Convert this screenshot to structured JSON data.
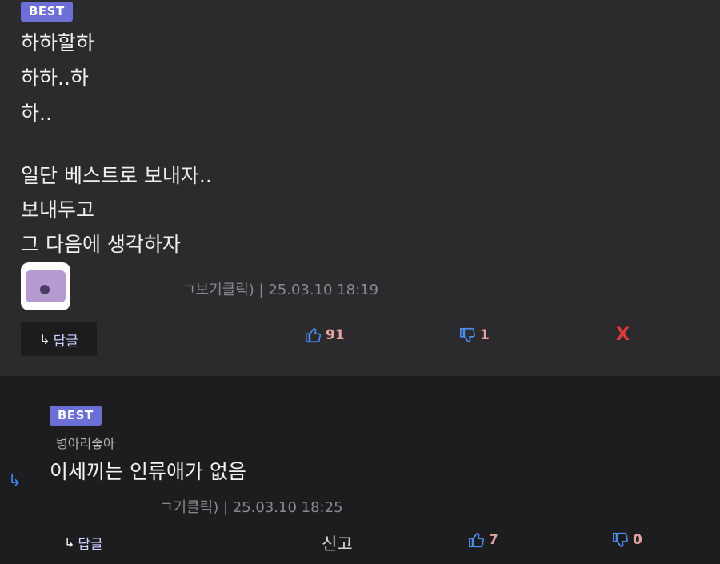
{
  "comment1": {
    "badge": "BEST",
    "lines": [
      "하하할하",
      "하하..하",
      "하..",
      "",
      "일단 베스트로 보내자..",
      "보내두고",
      "그 다음에 생각하자"
    ],
    "meta": "ㄱ보기클릭) | 25.03.10 18:19",
    "reply_label": "답글",
    "upvotes": "91",
    "downvotes": "1",
    "delete_label": "X"
  },
  "comment2": {
    "badge": "BEST",
    "nickname": "병아리좋아",
    "text": "이세끼는 인류애가 없음",
    "meta": "ㄱ기클릭) | 25.03.10 18:25",
    "reply_label": "답글",
    "report_label": "신고",
    "upvotes": "7",
    "downvotes": "0"
  },
  "colors": {
    "badge": "#6b6fd6",
    "count": "#e7a3a3",
    "delete": "#e03b3b",
    "reply_indicator": "#3d8bff"
  }
}
